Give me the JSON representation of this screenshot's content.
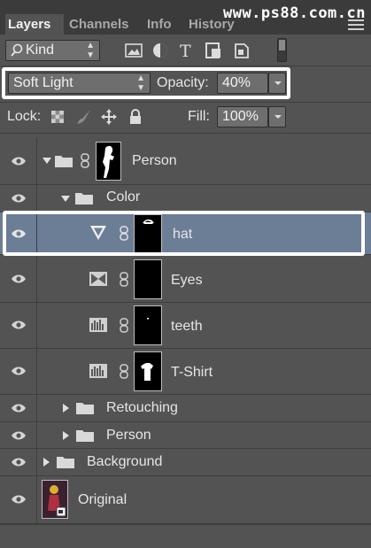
{
  "watermark": "www.ps88.com.cn",
  "tabs": [
    {
      "label": "Layers",
      "active": true
    },
    {
      "label": "Channels",
      "active": false
    },
    {
      "label": "Info",
      "active": false
    },
    {
      "label": "History",
      "active": false
    }
  ],
  "filter": {
    "kind_label": "Kind",
    "icons": [
      "image-filter-icon",
      "adjustment-filter-icon",
      "type-filter-icon",
      "shape-filter-icon",
      "smart-object-filter-icon"
    ]
  },
  "blend": {
    "mode": "Soft Light",
    "opacity_label": "Opacity:",
    "opacity_value": "40%"
  },
  "lock": {
    "label": "Lock:",
    "fill_label": "Fill:",
    "fill_value": "100%"
  },
  "layers": [
    {
      "name": "Person",
      "type": "group",
      "expanded": true,
      "level": 0
    },
    {
      "name": "Color",
      "type": "group",
      "expanded": true,
      "level": 1
    },
    {
      "name": "hat",
      "type": "gradient-adjustment",
      "selected": true,
      "level": 2
    },
    {
      "name": "Eyes",
      "type": "vibrance-adjustment",
      "level": 2
    },
    {
      "name": "teeth",
      "type": "levels-adjustment",
      "level": 2
    },
    {
      "name": "T-Shirt",
      "type": "levels-adjustment",
      "level": 2
    },
    {
      "name": "Retouching",
      "type": "group",
      "expanded": false,
      "level": 1
    },
    {
      "name": "Person",
      "type": "group",
      "expanded": false,
      "level": 1
    },
    {
      "name": "Background",
      "type": "group",
      "expanded": false,
      "level": 0
    },
    {
      "name": "Original",
      "type": "smart-object",
      "level": 0
    }
  ],
  "colors": {
    "panel_bg": "#535353",
    "tab_bar_bg": "#3b3b3b",
    "selected_row": "#6c7e96",
    "highlight_frame": "#ffffff"
  }
}
